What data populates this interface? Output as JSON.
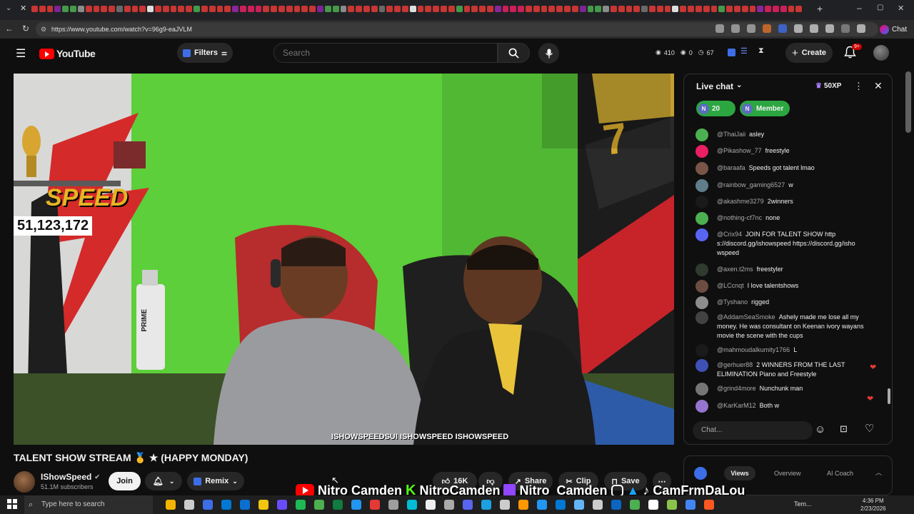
{
  "browser": {
    "url": "https://www.youtube.com/watch?v=96g9-eaJVLM",
    "chat_button": "Chat"
  },
  "header": {
    "logo_text": "YouTube",
    "filters_label": "Filters",
    "search_placeholder": "Search",
    "stat_views": "410",
    "stat_zero": "0",
    "stat_other": "67",
    "create_label": "Create",
    "notif_badge": "9+"
  },
  "video": {
    "sub_counter": "51,123,172",
    "overlay_socials": "ISHOWSPEEDSUI  ISHOWSPEED  ISHOWSPEED",
    "wall_text": "SPEED",
    "bottle_text": "PRIME"
  },
  "meta": {
    "title": "TALENT SHOW STREAM 🥇 ★ (HAPPY MONDAY)",
    "channel": "IShowSpeed",
    "subscribers": "51.1M subscribers",
    "join_label": "Join",
    "remix_label": "Remix",
    "likes": "16K",
    "share_label": "Share",
    "clip_label": "Clip",
    "save_label": "Save"
  },
  "socials_banner": {
    "items": [
      "Nitro Camden",
      "NitroCamden",
      "Nitro_Camden",
      "CamFrmDaLou"
    ]
  },
  "chat": {
    "title": "Live chat",
    "xp": "50XP",
    "badge_count": "20",
    "member_label": "Member",
    "input_placeholder": "Chat...",
    "messages": [
      {
        "author": "@ThaiJaii",
        "text": "asley",
        "color": "#4caf50"
      },
      {
        "author": "@Pikashow_77",
        "text": "freestyle",
        "color": "#e91e63"
      },
      {
        "author": "@baraafa",
        "text": "Speeds got talent lmao",
        "color": "#795548"
      },
      {
        "author": "@rainbow_gaming6527",
        "text": "w",
        "color": "#607d8b"
      },
      {
        "author": "@akashme3279",
        "text": "2winners",
        "color": "#1a1a1a"
      },
      {
        "author": "@nothing-cf7nc",
        "text": "none",
        "color": "#4caf50"
      },
      {
        "author": "@Crix94",
        "text": "JOIN FOR TALENT SHOW http s://discord.gg/ishowspeed https://discord.gg/isho wspeed",
        "color": "#5865f2"
      },
      {
        "author": "@axen.t2ms",
        "text": "freestyler",
        "color": "#2e3b2e"
      },
      {
        "author": "@LCcnqt",
        "text": "I love talentshows",
        "color": "#6d4c41"
      },
      {
        "author": "@Tyshano",
        "text": "rigged",
        "color": "#8d8d8d"
      },
      {
        "author": "@AddamSeaSmoke",
        "text": "Ashely made me lose all my money. He was consultant on Keenan ivory wayans movie the scene with the cups",
        "color": "#424242"
      },
      {
        "author": "@mahmoudalkumity1766",
        "text": "L",
        "color": "#1a1a1a"
      },
      {
        "author": "@gerhuer88",
        "text": "2 WINNERS FROM THE LAST ELIMINATION Piano and Freestyle",
        "color": "#3f51b5"
      },
      {
        "author": "@grind4more",
        "text": "Nunchunk man",
        "color": "#757575"
      },
      {
        "author": "@KarKarM12",
        "text": "Both w",
        "color": "#9575cd"
      }
    ]
  },
  "panel": {
    "tab_views": "Views",
    "tab_overview": "Overview",
    "tab_coach": "AI Coach"
  },
  "taskbar": {
    "search_placeholder": "Type here to search",
    "time": "4:36 PM",
    "date": "2/23/2026",
    "temp": "Tem..."
  }
}
